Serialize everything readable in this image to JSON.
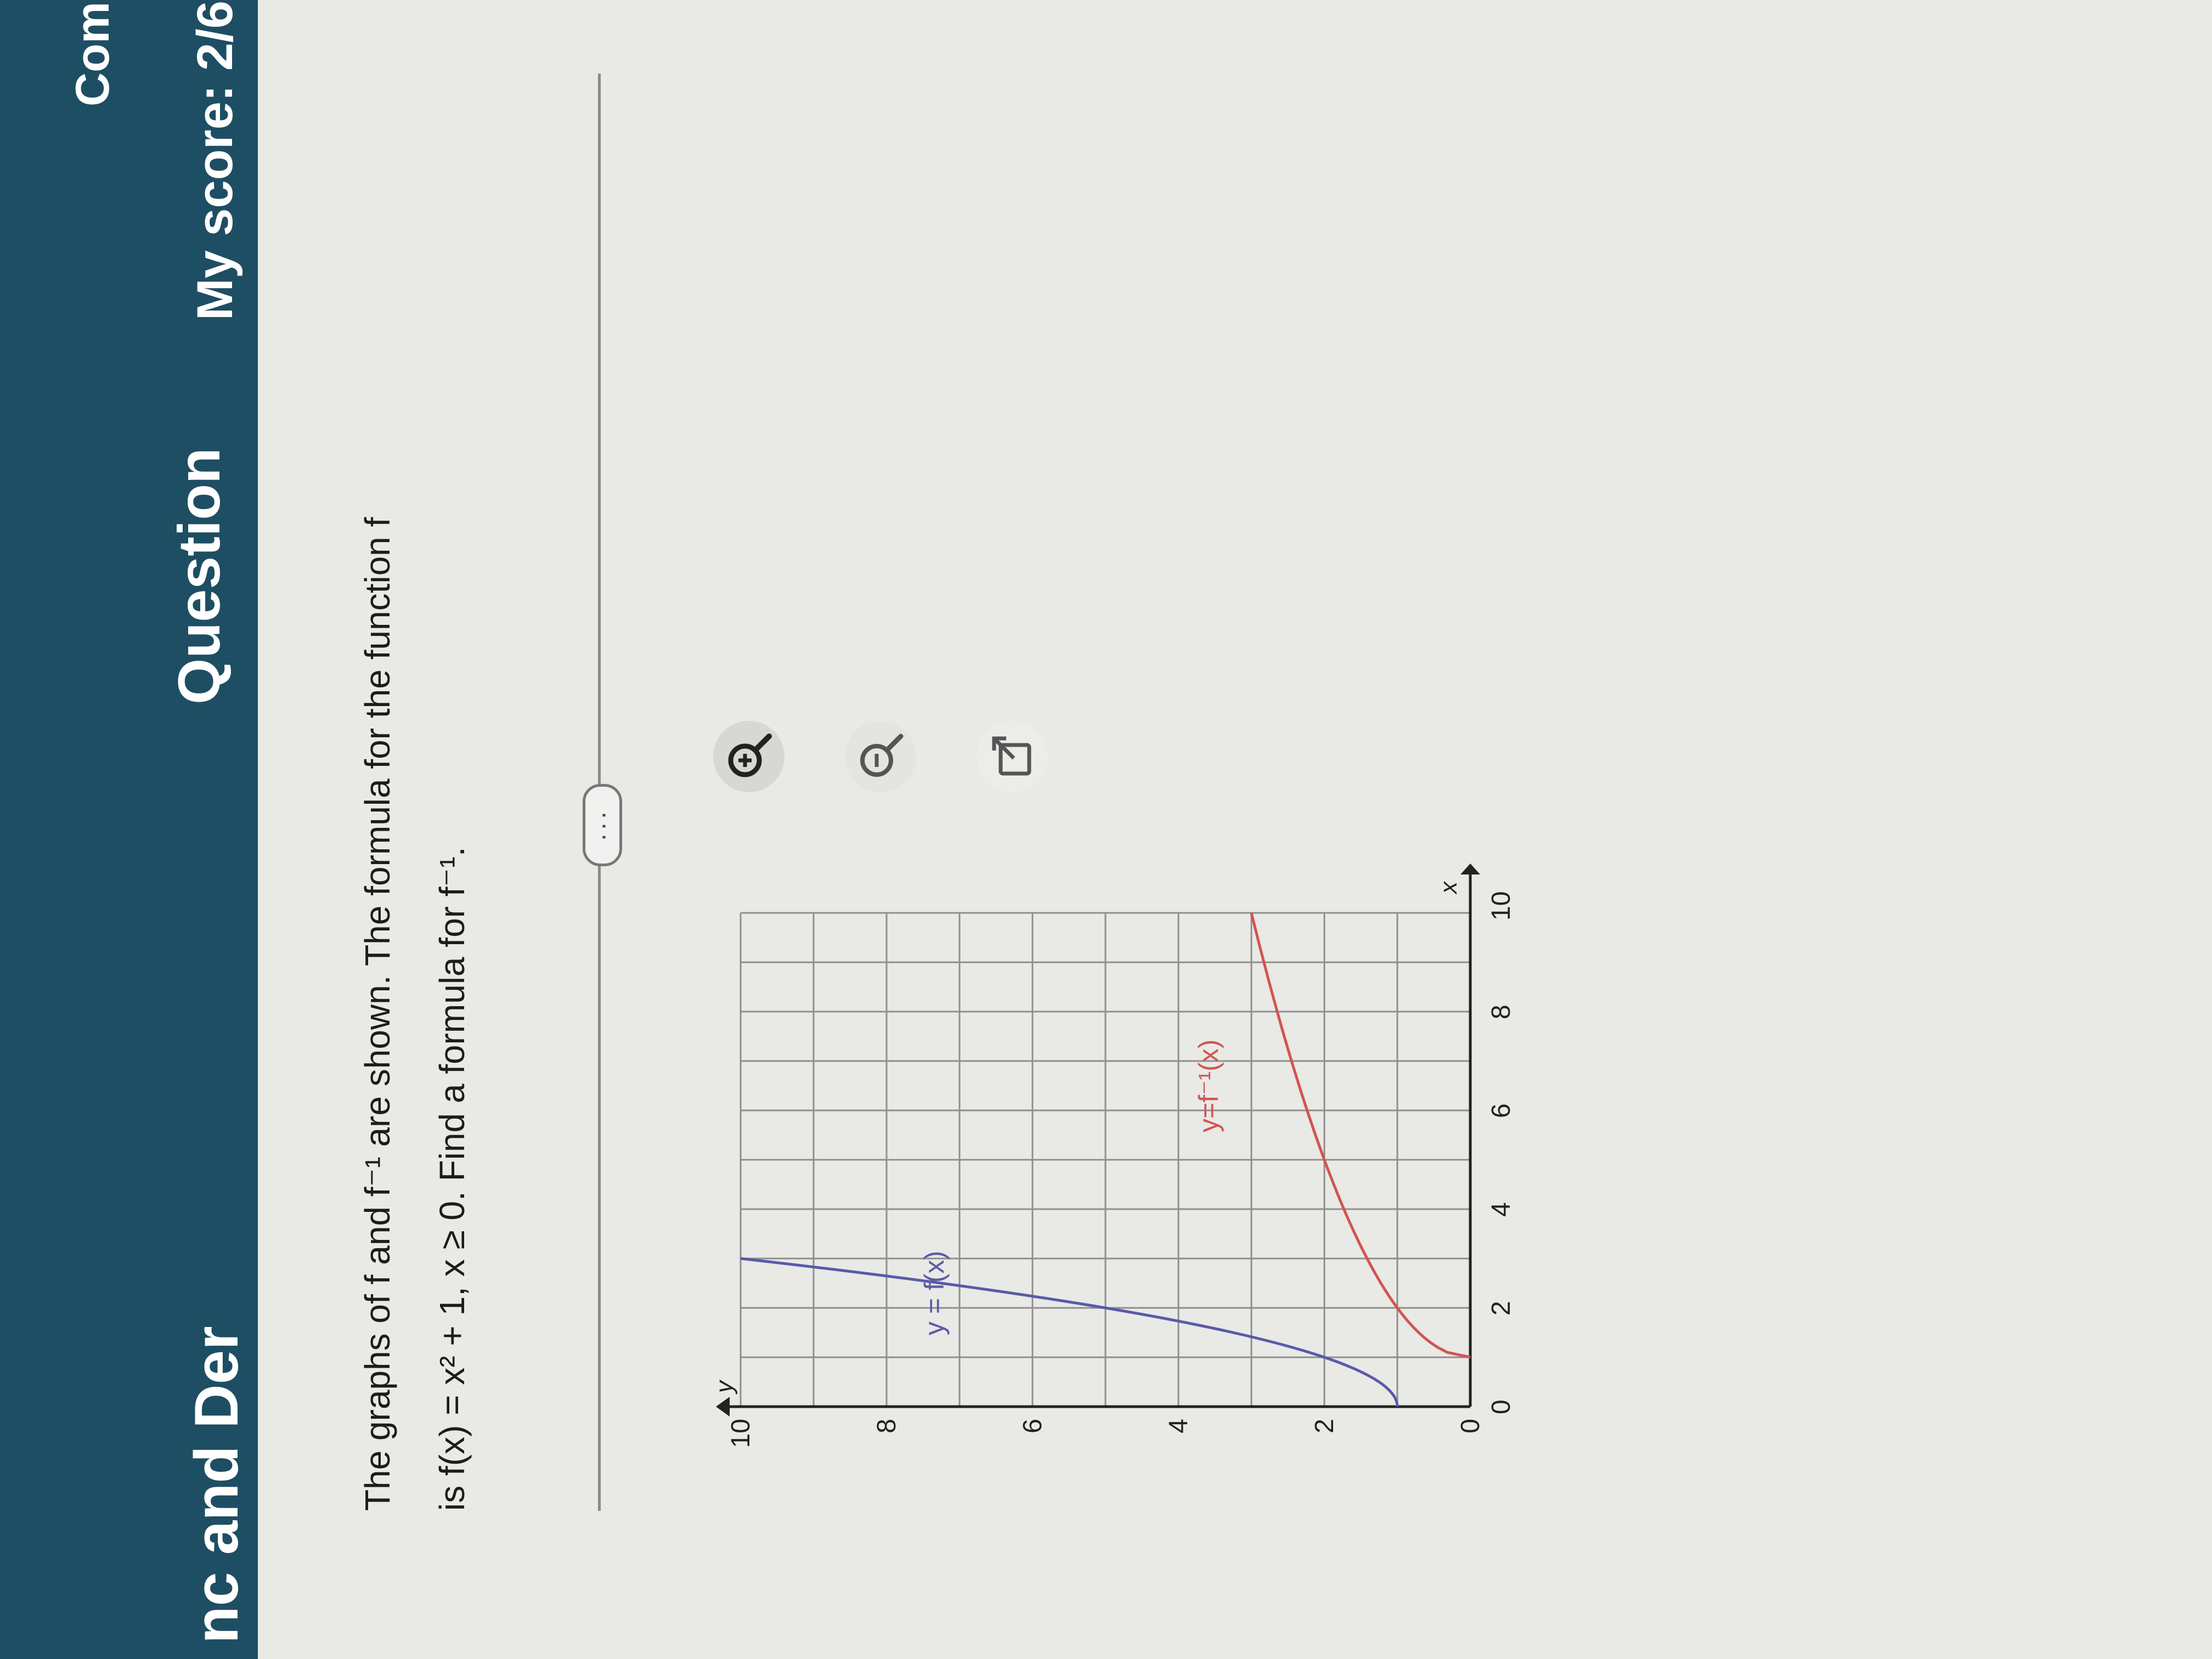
{
  "header": {
    "title": "nc and Der",
    "question_label": "Question",
    "comp_label": "Com",
    "score": "My score: 2/6"
  },
  "question": {
    "line1": "The graphs of f and f⁻¹ are shown. The formula for the function f",
    "line2": "is f(x) = x² + 1, x ≥ 0. Find a formula for f⁻¹."
  },
  "more_button": "···",
  "graph": {
    "x_axis_label": "x",
    "y_axis_label": "y",
    "x_ticks": [
      "0",
      "2",
      "4",
      "6",
      "8",
      "10"
    ],
    "y_ticks": [
      "0",
      "2",
      "4",
      "6",
      "8",
      "10"
    ],
    "f_label": "y = f(x)",
    "finv_label": "y=f⁻¹(x)",
    "f_color": "#5a5aa8",
    "finv_color": "#d05550"
  },
  "tools": {
    "zoom_in": "zoom-in-icon",
    "zoom_out": "zoom-out-icon",
    "popout": "popout-icon"
  }
}
